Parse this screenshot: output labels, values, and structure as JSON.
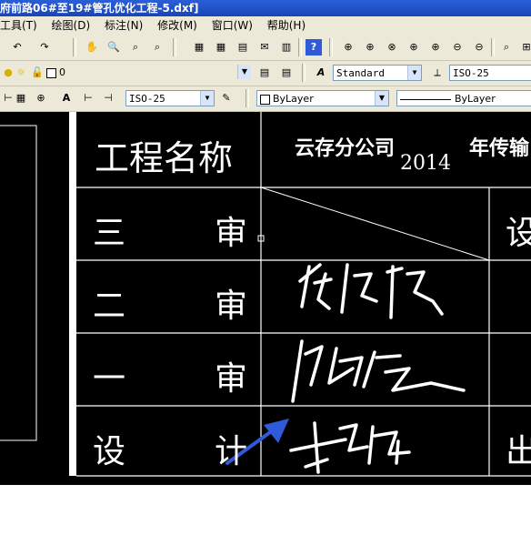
{
  "window": {
    "title": "府前路06#至19#管孔优化工程-5.dxf]"
  },
  "menu": {
    "items": [
      "工具(T)",
      "绘图(D)",
      "标注(N)",
      "修改(M)",
      "窗口(W)",
      "帮助(H)"
    ]
  },
  "layer_toolbar": {
    "layer_value": "0"
  },
  "styles_toolbar": {
    "text_style": "Standard",
    "dim_style": "ISO-25"
  },
  "dim_toolbar": {
    "dim_style": "ISO-25",
    "layer_value": "ByLayer",
    "linetype_value": "ByLayer"
  },
  "drawing": {
    "project_label": "工程名称",
    "project_name": "云存分公司",
    "project_name_suffix": "年传输",
    "year": "2014",
    "rows": [
      {
        "label_left": "三",
        "label_right": "审"
      },
      {
        "label_left": "二",
        "label_right": "审"
      },
      {
        "label_left": "一",
        "label_right": "审"
      },
      {
        "label_left": "设",
        "label_right": "计"
      }
    ],
    "right_col_labels": [
      "设",
      "出"
    ]
  },
  "colors": {
    "canvas": "#000000",
    "lines": "#ffffff",
    "arrow": "#2f5ad8",
    "ui": "#ece9d8",
    "title": "#1f4fc8"
  }
}
